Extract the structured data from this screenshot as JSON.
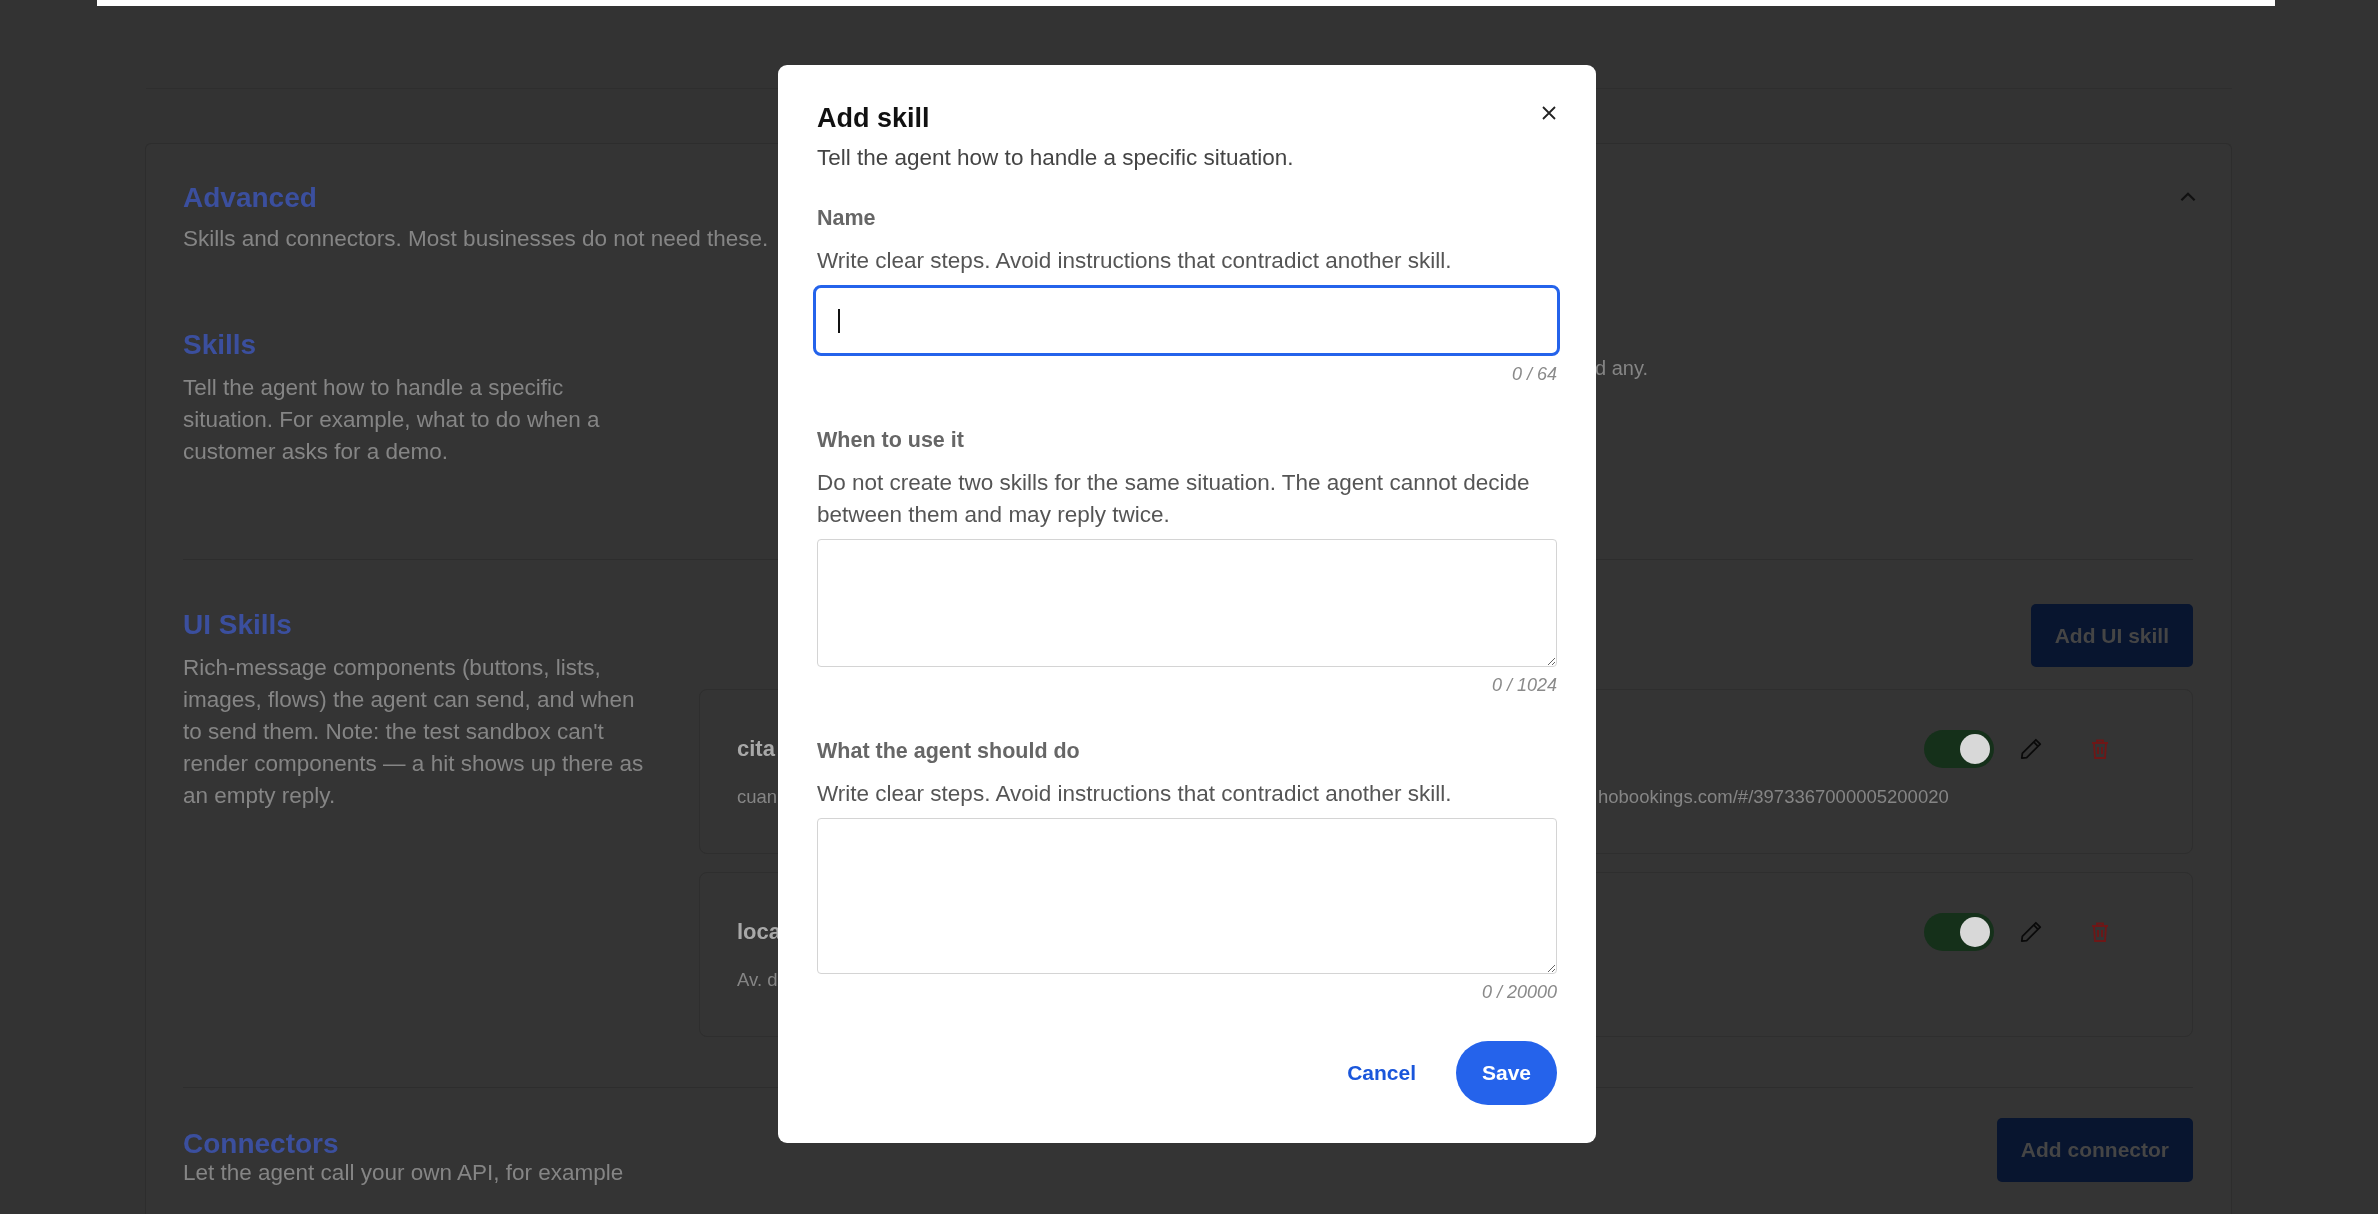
{
  "page": {
    "advanced": {
      "title": "Advanced",
      "subtitle": "Skills and connectors. Most businesses do not need these.",
      "expanded": true
    },
    "skills": {
      "title": "Skills",
      "description": "Tell the agent how to handle a specific situation. For example, what to do when a customer asks for a demo.",
      "note_fragment": "d any."
    },
    "ui_skills": {
      "title": "UI Skills",
      "description": "Rich-message components (buttons, lists, images, flows) the agent can send, and when to send them. Note: the test sandbox can't render components — a hit shows up there as an empty reply.",
      "add_button": "Add UI skill",
      "items": [
        {
          "name": "cita",
          "detail_start": "cuan",
          "detail_end": "hobookings.com/#/3973367000005200020",
          "on": true
        },
        {
          "name": "loca",
          "detail_start": "Av. d",
          "on": true
        }
      ]
    },
    "connectors": {
      "title": "Connectors",
      "description": "Let the agent call your own API, for example",
      "add_button": "Add connector"
    }
  },
  "dialog": {
    "title": "Add skill",
    "subtitle": "Tell the agent how to handle a specific situation.",
    "fields": [
      {
        "kind": "input",
        "label": "Name",
        "hint": "Write clear steps. Avoid instructions that contradict another skill.",
        "counter": "0 / 64",
        "focused": true
      },
      {
        "kind": "textarea",
        "label": "When to use it",
        "hint": "Do not create two skills for the same situation. The agent cannot decide between them and may reply twice.",
        "counter": "0 / 1024",
        "focused": false
      },
      {
        "kind": "textarea",
        "label": "What the agent should do",
        "hint": "Write clear steps. Avoid instructions that contradict another skill.",
        "counter": "0 / 20000",
        "focused": false
      }
    ],
    "cancel": "Cancel",
    "save": "Save"
  }
}
